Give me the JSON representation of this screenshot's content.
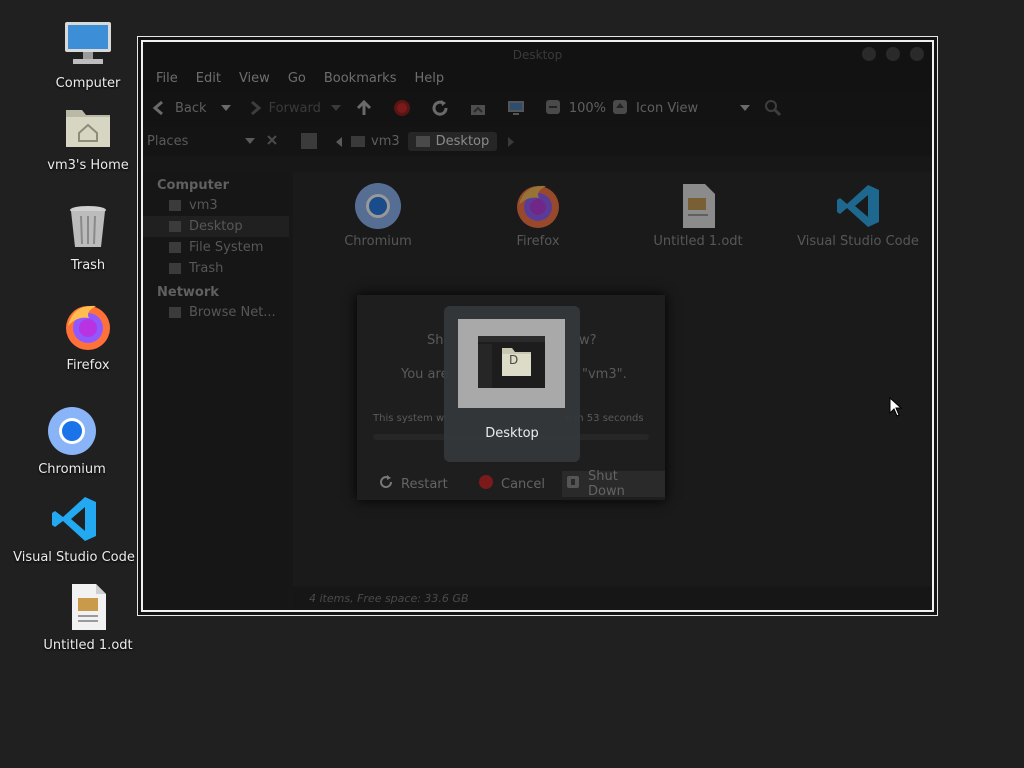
{
  "desktop": {
    "icons": [
      {
        "label": "Computer",
        "icon": "computer-icon"
      },
      {
        "label": "vm3's Home",
        "icon": "home-folder-icon"
      },
      {
        "label": "Trash",
        "icon": "trash-icon"
      },
      {
        "label": "Firefox",
        "icon": "firefox-icon"
      },
      {
        "label": "Chromium",
        "icon": "chromium-icon"
      },
      {
        "label": "Visual Studio Code",
        "icon": "vscode-icon"
      },
      {
        "label": "Untitled 1.odt",
        "icon": "document-icon"
      }
    ]
  },
  "file_manager": {
    "title": "Desktop",
    "menu": [
      "File",
      "Edit",
      "View",
      "Go",
      "Bookmarks",
      "Help"
    ],
    "toolbar": {
      "back": "Back",
      "forward": "Forward",
      "zoom": "100%",
      "view_mode": "Icon View"
    },
    "places_header": "Places",
    "breadcrumb": [
      "vm3",
      "Desktop"
    ],
    "sidebar": {
      "computer_heading": "Computer",
      "computer_items": [
        "vm3",
        "Desktop",
        "File System",
        "Trash"
      ],
      "network_heading": "Network",
      "network_items": [
        "Browse Net..."
      ]
    },
    "files": [
      "Chromium",
      "Firefox",
      "Untitled 1.odt",
      "Visual Studio Code"
    ],
    "status": "4 items, Free space: 33.6 GB"
  },
  "dialog": {
    "title_partial_left": "Sh",
    "title_partial_right": "w?",
    "line2_left": "You are",
    "line2_right": "\"vm3\".",
    "timer_left": "This system wi",
    "timer_right": "n in 53 seconds",
    "buttons": [
      "Restart",
      "Cancel",
      "Shut Down"
    ]
  },
  "switcher": {
    "label": "Desktop",
    "thumb_letter": "D"
  },
  "colors": {
    "desktop_bg": "#202020",
    "switcher_bg": "#34383c",
    "firefox_orange": "#ff7139",
    "chromium_blue": "#1a73e8",
    "vscode_blue": "#23a9f2"
  }
}
